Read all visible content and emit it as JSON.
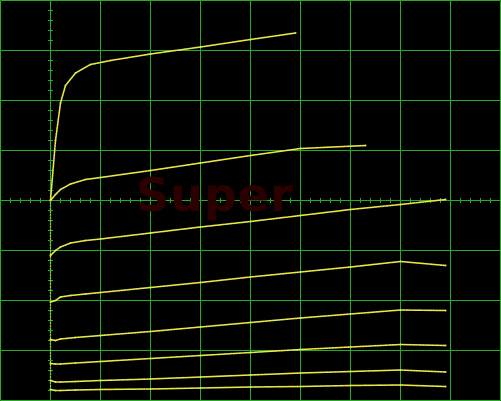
{
  "screen": {
    "background_color": "#000000",
    "grid_color": "#22b022",
    "trace_color": "#e8e84a",
    "watermark_color": "#2a0000"
  },
  "watermark": {
    "text": "Super"
  },
  "chart_data": {
    "type": "line",
    "title": "",
    "xlabel": "",
    "ylabel": "",
    "grid": true,
    "legend": "none",
    "xlim": [
      -1,
      9
    ],
    "ylim": [
      -4,
      4
    ],
    "divisions": {
      "x": 10,
      "y": 8
    },
    "series": [
      {
        "x": [
          0,
          0.1,
          0.2,
          0.3,
          0.5,
          0.8,
          1.2,
          2.0,
          3.0,
          4.0,
          4.9
        ],
        "y": [
          0,
          1.2,
          1.95,
          2.3,
          2.55,
          2.72,
          2.8,
          2.93,
          3.07,
          3.22,
          3.35
        ]
      },
      {
        "x": [
          0,
          0.1,
          0.2,
          0.4,
          0.7,
          1.0,
          2.0,
          3.0,
          4.0,
          5.0,
          6.3
        ],
        "y": [
          0,
          0.12,
          0.22,
          0.33,
          0.42,
          0.46,
          0.6,
          0.75,
          0.9,
          1.04,
          1.1
        ]
      },
      {
        "x": [
          0,
          0.1,
          0.2,
          0.4,
          0.7,
          1.0,
          2.0,
          3.0,
          4.0,
          5.0,
          6.0,
          7.0,
          7.9
        ],
        "y": [
          -1.1,
          -1.0,
          -0.93,
          -0.85,
          -0.8,
          -0.77,
          -0.65,
          -0.53,
          -0.42,
          -0.3,
          -0.18,
          -0.08,
          0.02
        ]
      },
      {
        "x": [
          0,
          0.1,
          0.2,
          0.4,
          0.7,
          1.0,
          2.0,
          3.0,
          4.0,
          5.0,
          6.0,
          7.0,
          7.9
        ],
        "y": [
          -2.03,
          -2.0,
          -1.93,
          -1.9,
          -1.87,
          -1.84,
          -1.74,
          -1.64,
          -1.53,
          -1.43,
          -1.33,
          -1.22,
          -1.3
        ]
      },
      {
        "x": [
          0,
          0.1,
          0.2,
          0.5,
          1.0,
          2.0,
          3.0,
          4.0,
          5.0,
          6.0,
          7.0,
          7.9
        ],
        "y": [
          -2.78,
          -2.8,
          -2.77,
          -2.74,
          -2.7,
          -2.62,
          -2.53,
          -2.44,
          -2.35,
          -2.27,
          -2.19,
          -2.2
        ]
      },
      {
        "x": [
          0,
          0.1,
          0.2,
          0.5,
          1.0,
          2.0,
          3.0,
          4.0,
          5.0,
          6.0,
          7.0,
          7.9
        ],
        "y": [
          -3.26,
          -3.27,
          -3.27,
          -3.25,
          -3.22,
          -3.16,
          -3.1,
          -3.04,
          -2.98,
          -2.93,
          -2.88,
          -2.9
        ]
      },
      {
        "x": [
          0,
          0.1,
          0.2,
          0.5,
          1.0,
          2.0,
          3.0,
          4.0,
          5.0,
          6.0,
          7.0,
          7.9
        ],
        "y": [
          -3.6,
          -3.63,
          -3.63,
          -3.62,
          -3.6,
          -3.57,
          -3.53,
          -3.49,
          -3.45,
          -3.42,
          -3.39,
          -3.43
        ]
      },
      {
        "x": [
          0,
          0.1,
          0.2,
          0.5,
          1.0,
          2.0,
          3.0,
          4.0,
          5.0,
          6.0,
          7.0,
          7.9
        ],
        "y": [
          -3.78,
          -3.8,
          -3.8,
          -3.79,
          -3.78,
          -3.77,
          -3.75,
          -3.73,
          -3.72,
          -3.7,
          -3.69,
          -3.72
        ]
      }
    ]
  }
}
